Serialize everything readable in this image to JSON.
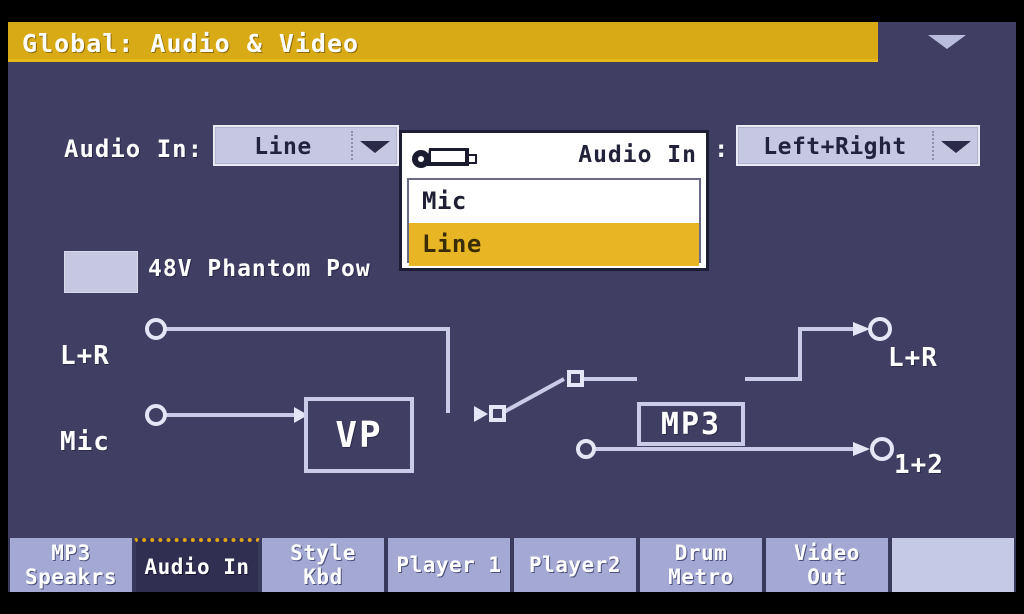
{
  "window": {
    "title": "Global: Audio & Video",
    "page_menu_icon": "chevron-down-icon"
  },
  "settings": {
    "audio_in_label": "Audio In:",
    "audio_in_value": "Line",
    "audio_in_options": [
      "Mic",
      "Line"
    ],
    "channel_colon": ":",
    "channel_value": "Left+Right",
    "phantom_label": "48V Phantom Pow",
    "phantom_checked": false
  },
  "popup": {
    "pin_icon": "pin-icon",
    "title": "Audio In",
    "options": [
      {
        "label": "Mic",
        "selected": false
      },
      {
        "label": "Line",
        "selected": true
      }
    ]
  },
  "diagram": {
    "inputs": [
      {
        "label": "L+R"
      },
      {
        "label": "Mic"
      }
    ],
    "blocks": [
      {
        "label": "VP"
      },
      {
        "label": "MP3"
      }
    ],
    "outputs": [
      {
        "label": "L+R"
      },
      {
        "label": "1+2"
      }
    ]
  },
  "tabs": [
    {
      "line1": "MP3",
      "line2": "Speakrs",
      "active": false
    },
    {
      "line1": "Audio In",
      "line2": "",
      "active": true
    },
    {
      "line1": "Style",
      "line2": "Kbd",
      "active": false
    },
    {
      "line1": "Player 1",
      "line2": "",
      "active": false
    },
    {
      "line1": "Player2",
      "line2": "",
      "active": false
    },
    {
      "line1": "Drum",
      "line2": "Metro",
      "active": false
    },
    {
      "line1": "Video",
      "line2": "Out",
      "active": false
    },
    {
      "line1": "",
      "line2": "",
      "active": false
    }
  ],
  "colors": {
    "title_bar": "#d8aa16",
    "lcd_background": "#403f63",
    "accent_gold": "#e8b624",
    "control_fill": "#c6c8e2",
    "active_tab": "#302f52",
    "tab_fill": "#a4a9d4"
  }
}
